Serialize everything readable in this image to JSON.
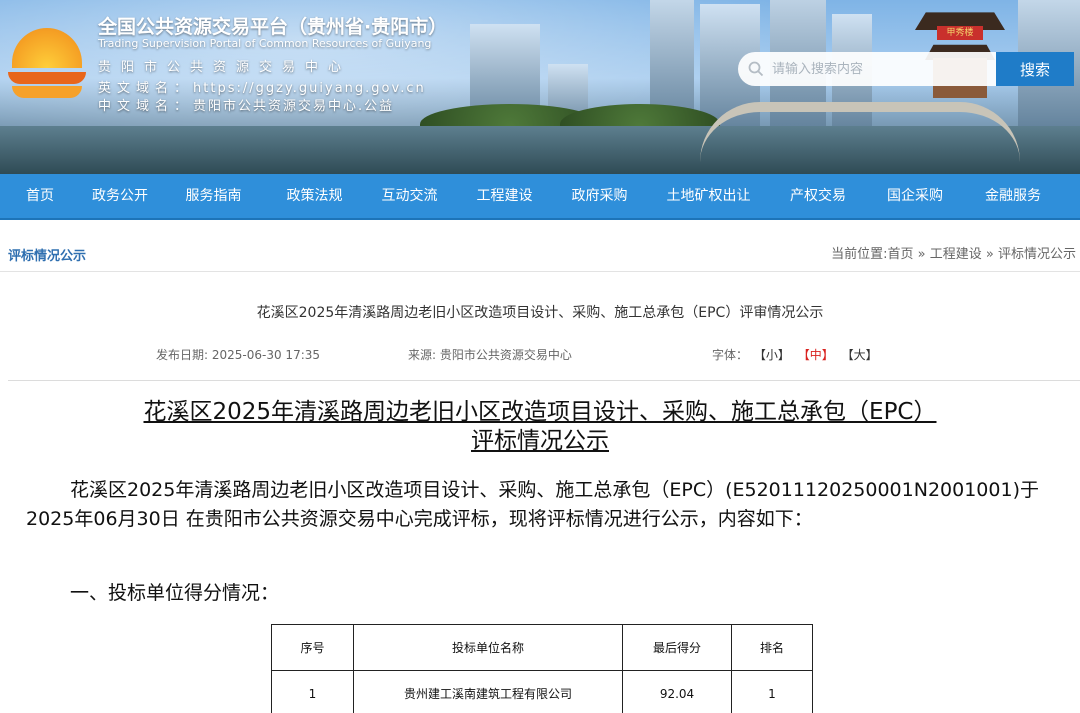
{
  "header": {
    "title": "全国公共资源交易平台（贵州省·贵阳市）",
    "subtitle_en": "Trading Supervision Portal of Common Resources of Guiyang",
    "org_name": "贵阳市公共资源交易中心",
    "en_domain_label": "英文域名：",
    "en_domain": "https://ggzy.guiyang.gov.cn",
    "cn_domain_label": "中文域名：",
    "cn_domain": "贵阳市公共资源交易中心.公益",
    "pavilion_sign": "甲秀楼"
  },
  "search": {
    "placeholder": "请输入搜索内容",
    "button_label": "搜索"
  },
  "nav": {
    "items": [
      "首页",
      "政务公开",
      "服务指南",
      "政策法规",
      "互动交流",
      "工程建设",
      "政府采购",
      "土地矿权出让",
      "产权交易",
      "国企采购",
      "金融服务"
    ]
  },
  "breadcrumb": {
    "section": "评标情况公示",
    "prefix": "当前位置:",
    "home": "首页",
    "sep": "»",
    "level1": "工程建设",
    "level2": "评标情况公示"
  },
  "article": {
    "title": "花溪区2025年清溪路周边老旧小区改造项目设计、采购、施工总承包（EPC）评审情况公示",
    "publish_label": "发布日期:",
    "publish_date": "2025-06-30 17:35",
    "source_label": "来源:",
    "source": "贵阳市公共资源交易中心",
    "font_label": "字体：",
    "font_small": "小",
    "font_medium": "中",
    "font_large": "大"
  },
  "content": {
    "doc_title_line1": "花溪区2025年清溪路周边老旧小区改造项目设计、采购、施工总承包（EPC）",
    "doc_title_line2": "评标情况公示",
    "intro": "花溪区2025年清溪路周边老旧小区改造项目设计、采购、施工总承包（EPC）(E52011120250001N2001001)于2025年06月30日 在贵阳市公共资源交易中心完成评标，现将评标情况进行公示，内容如下：",
    "section1": "一、投标单位得分情况：",
    "table": {
      "headers": [
        "序号",
        "投标单位名称",
        "最后得分",
        "排名"
      ],
      "rows": [
        [
          "1",
          "贵州建工溪南建筑工程有限公司",
          "92.04",
          "1"
        ]
      ]
    }
  },
  "colors": {
    "nav_bg": "#2f8fda",
    "search_button": "#1f7cc8",
    "accent_red": "#d9221f",
    "section_blue": "#2f6fb0"
  }
}
